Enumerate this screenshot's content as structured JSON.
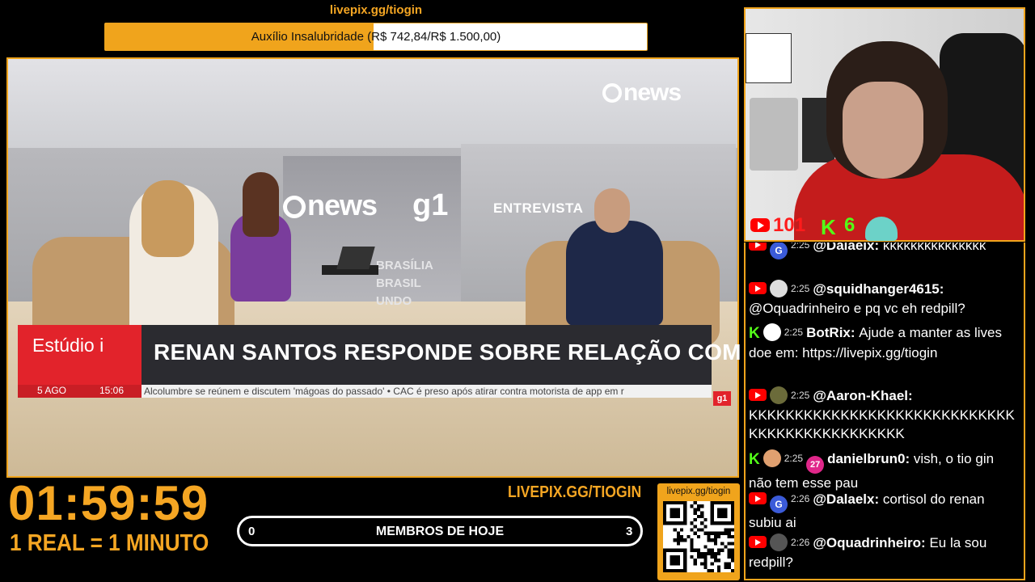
{
  "goal": {
    "url": "livepix.gg/tiogin",
    "label": "Auxílio Insalubridade (R$ 742,84/R$ 1.500,00)",
    "progress_percent": 49.5
  },
  "broadcast": {
    "channel_logo": "news",
    "wall_logo": "news",
    "wall_g1": "g1",
    "wall_entrevista": "ENTREVISTA",
    "wall_text_1": "BRASÍLIA",
    "wall_text_2": "BRASIL",
    "wall_text_3": "UNDO",
    "show": "Estúdio i",
    "date": "5 AGO",
    "time": "15:06",
    "headline": "RENAN SANTOS RESPONDE SOBRE RELAÇÃO COM STF",
    "ticker": "Alcolumbre se reúnem e discutem 'mágoas do passado'  •  CAC é preso após atirar contra motorista de app em r",
    "badge": "g1"
  },
  "timer": {
    "value": "01:59:59",
    "rate": "1 REAL = 1 MINUTO"
  },
  "members": {
    "livepix_label": "LIVEPIX.GG/TIOGIN",
    "count_left": "0",
    "label": "MEMBROS DE HOJE",
    "count_right": "3"
  },
  "qr": {
    "url": "livepix.gg/tiogin"
  },
  "webcam": {
    "youtube_viewers": "101",
    "kick_viewers": "6",
    "kick_icon": "K"
  },
  "chat": {
    "messages": [
      {
        "platform": "youtube",
        "time": "2:25",
        "user": "@Dalaelx:",
        "text": "kkkkkkkkkkkkkkk",
        "avatar": "G",
        "avatar_color": "#3b5bd9"
      },
      {
        "platform": "youtube",
        "time": "2:25",
        "user": "@squidhanger4615:",
        "text": "@Oquadrinheiro e pq vc eh redpill?",
        "avatar": "",
        "avatar_color": "#ddd"
      },
      {
        "platform": "kick",
        "time": "2:25",
        "user": "BotRix:",
        "text": "Ajude a manter as lives doe em: https://livepix.gg/tiogin",
        "avatar": "",
        "avatar_color": "#fff"
      },
      {
        "platform": "youtube",
        "time": "2:25",
        "user": "@Aaron-Khael:",
        "text": "KKKKKKKKKKKKKKKKKKKKKKKKKKKKKKKKKKKKKKKKKKKKKK",
        "avatar": "",
        "avatar_color": "#6b6b3a"
      },
      {
        "platform": "kick",
        "time": "2:25",
        "user": "danielbrun0:",
        "text": "vish, o tio gin não tem esse pau",
        "avatar": "",
        "avatar_color": "#e0a070",
        "sub_badge": "27"
      },
      {
        "platform": "youtube",
        "time": "2:26",
        "user": "@Dalaelx:",
        "text": "cortisol do renan subiu ai",
        "avatar": "G",
        "avatar_color": "#3b5bd9"
      },
      {
        "platform": "youtube",
        "time": "2:26",
        "user": "@Oquadrinheiro:",
        "text": "Eu la sou redpill?",
        "avatar": "",
        "avatar_color": "#555"
      }
    ]
  },
  "colors": {
    "accent": "#f0a41c",
    "youtube": "#ff0000",
    "kick": "#53fc18",
    "news_red": "#e2232b"
  }
}
